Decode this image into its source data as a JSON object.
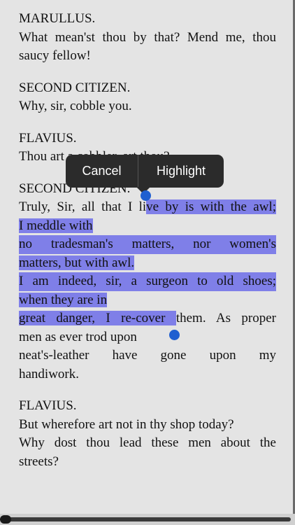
{
  "book": {
    "blocks": [
      {
        "speaker": "MARULLUS.",
        "lines": [
          "What mean'st thou by that? Mend me, thou",
          "saucy fellow!"
        ]
      },
      {
        "speaker": "SECOND CITIZEN.",
        "lines": [
          "Why, sir, cobble you."
        ]
      },
      {
        "speaker": "FLAVIUS.",
        "lines": [
          "Thou art a cobbler, art thou?"
        ]
      },
      {
        "speaker": "SECOND CITIZEN."
      }
    ],
    "selected_passage": {
      "line1_plain": "Truly, Sir, all that I li",
      "line1_hl": "ve by is with the awl;",
      "line2_hl": "I meddle with",
      "line3_hl": "no tradesman's matters, nor women's",
      "line4_hl": "matters, but with awl.",
      "line5_hl": "I am indeed, sir, a surgeon to old shoes;",
      "line6_hl": "when they are in",
      "line7_hl": "great danger, I re-cover ",
      "line7_plain": "them. As proper",
      "line8": "men as ever trod upon",
      "line9": "neat's-leather have gone upon my",
      "line10": "handiwork."
    },
    "last_block": {
      "speaker": "FLAVIUS.",
      "lines": [
        "But wherefore art not in thy shop today?",
        "Why dost thou lead these men about the",
        "streets?"
      ]
    }
  },
  "selection_menu": {
    "cancel_label": "Cancel",
    "highlight_label": "Highlight"
  },
  "colors": {
    "highlight": "#7f7fe8",
    "handle": "#1f5fd0",
    "menu_bg": "#2b2b2b",
    "page_bg": "#e4e4e4"
  }
}
